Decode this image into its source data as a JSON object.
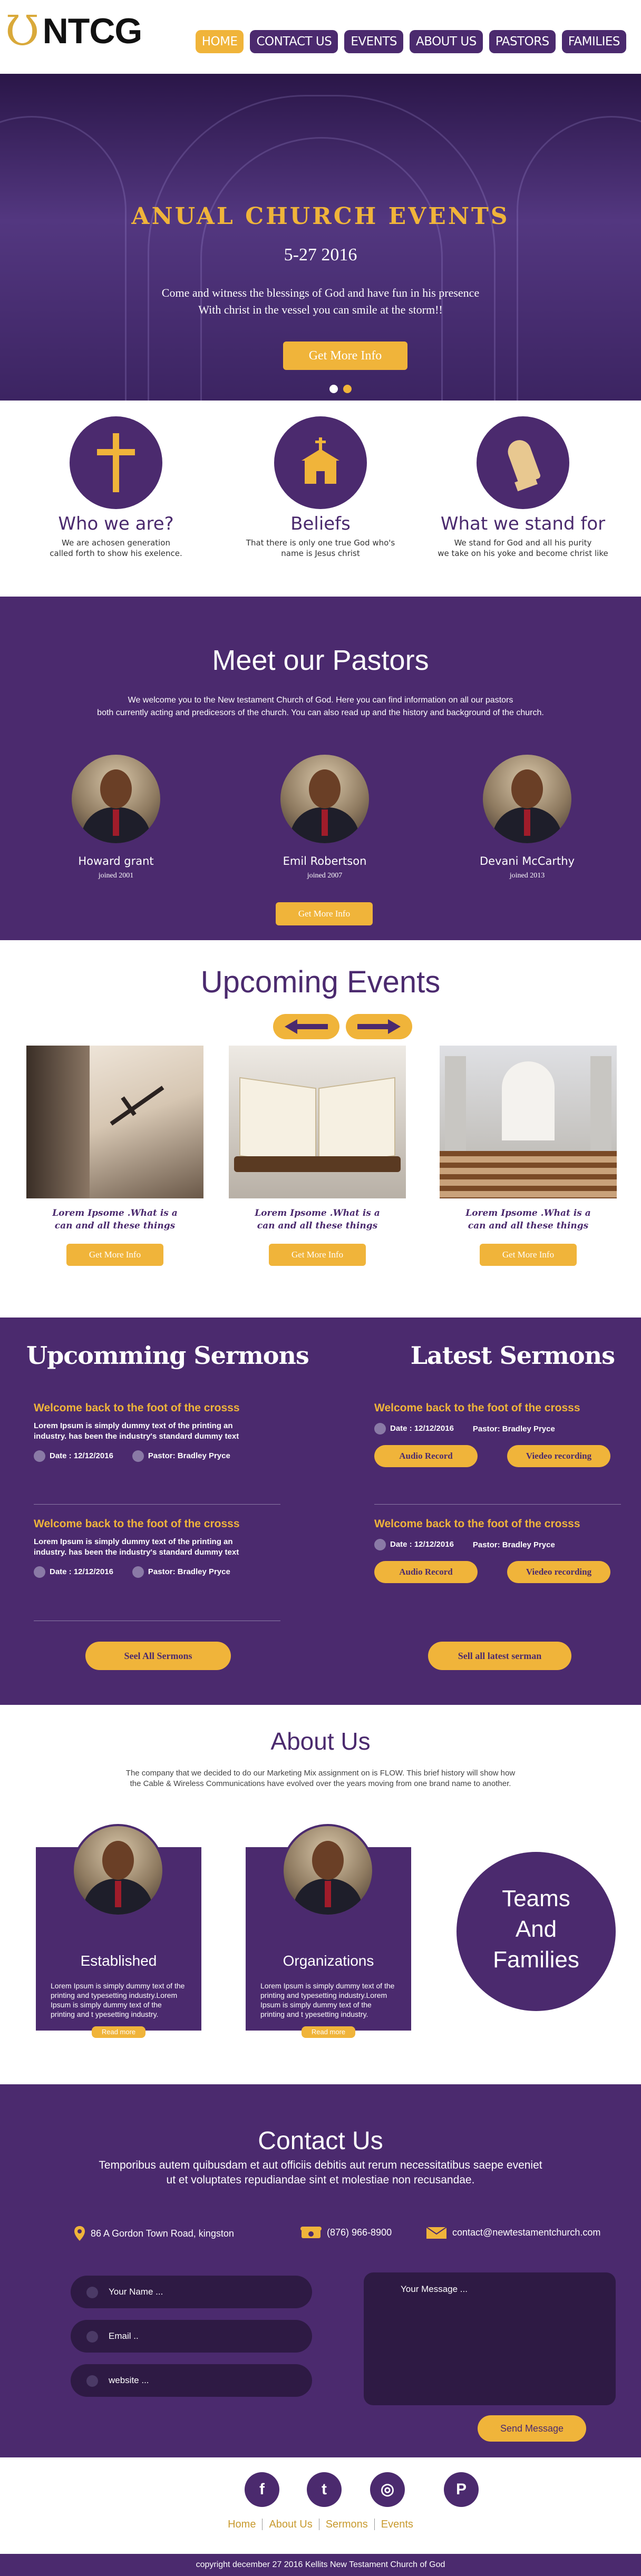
{
  "logo": {
    "mark": "Ʊ",
    "text": "NTCG"
  },
  "nav": {
    "items": [
      "HOME",
      "CONTACT US",
      "EVENTS",
      "ABOUT US",
      "PASTORS",
      "FAMILIES"
    ],
    "active": "HOME"
  },
  "hero": {
    "title": "ANUAL CHURCH EVENTS",
    "date": "5-27 2016",
    "line1": "Come and witness the blessings of God and have fun in his presence",
    "line2": "With christ in the vessel you can smile at the storm!!",
    "button": "Get More Info"
  },
  "features": [
    {
      "title": "Who we are?",
      "line1": "We are achosen generation",
      "line2": "called forth to show his exelence.",
      "icon": "cross-icon"
    },
    {
      "title": "Beliefs",
      "line1": "That there is only one true God who's",
      "line2": "name is Jesus christ",
      "icon": "church-icon"
    },
    {
      "title": "What we stand for",
      "line1": "We stand for God and all his purity",
      "line2": "we take on his yoke and become christ like",
      "icon": "praying-hands-icon"
    }
  ],
  "pastors": {
    "title": "Meet our Pastors",
    "intro1": "We welcome you to the New testament Church of God. Here you can find information on all our pastors",
    "intro2": "both currently acting and predicesors of the church. You can also read up and the history and background of the church.",
    "people": [
      {
        "name": "Howard grant",
        "joined": "joined 2001"
      },
      {
        "name": "Emil Robertson",
        "joined": "joined 2007"
      },
      {
        "name": "Devani McCarthy",
        "joined": "joined 2013"
      }
    ],
    "button": "Get More Info"
  },
  "events": {
    "title": "Upcoming Events",
    "items": [
      {
        "line1": "Lorem Ipsome .What is a",
        "line2": "can and all these things",
        "button": "Get More Info"
      },
      {
        "line1": "Lorem Ipsome .What is a",
        "line2": "can and all these things",
        "button": "Get More Info"
      },
      {
        "line1": "Lorem Ipsome .What is a",
        "line2": "can and all these things",
        "button": "Get More Info"
      }
    ]
  },
  "sermons": {
    "upcoming_title": "Upcomming Sermons",
    "latest_title": "Latest Sermons",
    "upcoming": [
      {
        "title": "Welcome back to the foot of the crosss",
        "body1": "Lorem Ipsum is simply dummy text of the printing an",
        "body2": "industry.  has been the industry's standard dummy text",
        "date": "Date : 12/12/2016",
        "pastor": "Pastor: Bradley Pryce"
      },
      {
        "title": "Welcome back to the foot of the crosss",
        "body1": "Lorem Ipsum is simply dummy text of the printing an",
        "body2": "industry.  has been the industry's standard dummy text",
        "date": "Date : 12/12/2016",
        "pastor": "Pastor: Bradley Pryce"
      }
    ],
    "latest": [
      {
        "title": "Welcome back to the foot of the crosss",
        "date": "Date : 12/12/2016",
        "pastor": "Pastor: Bradley Pryce",
        "audio": "Audio Record",
        "video": "Viedeo recording"
      },
      {
        "title": "Welcome back to the foot of the crosss",
        "date": "Date : 12/12/2016",
        "pastor": "Pastor: Bradley Pryce",
        "audio": "Audio Record",
        "video": "Viedeo recording"
      }
    ],
    "see_all": "Seel All Sermons",
    "see_latest": "Sell all latest serman"
  },
  "about": {
    "title": "About Us",
    "intro1": "The company that we decided to do our Marketing Mix assignment on is FLOW. This brief history will show how",
    "intro2": "the Cable & Wireless Communications have evolved over the years moving from one brand name to another.",
    "cards": [
      {
        "title": "Established",
        "body": "Lorem Ipsum is simply dummy text of the printing and typesetting industry.Lorem Ipsum is simply dummy text of the printing and t ypesetting industry.",
        "button": "Read more"
      },
      {
        "title": "Organizations",
        "body": "Lorem Ipsum is simply dummy text of the printing and typesetting industry.Lorem Ipsum is simply dummy text of the printing and t ypesetting industry.",
        "button": "Read more"
      }
    ],
    "teams": [
      "Teams",
      "And",
      "Families"
    ]
  },
  "contact": {
    "title": "Contact Us",
    "intro1": "Temporibus autem quibusdam et aut officiis debitis aut rerum necessitatibus saepe eveniet",
    "intro2": "ut et voluptates repudiandae sint et molestiae non recusandae.",
    "address": "86 A Gordon Town Road, kingston",
    "phone": "(876) 966-8900",
    "email": "contact@newtestamentchurch.com",
    "name_placeholder": "Your Name ...",
    "email_placeholder": "Email ..",
    "website_placeholder": "website ...",
    "message_placeholder": "Your Message ...",
    "send": "Send Message"
  },
  "footer": {
    "social": [
      "f",
      "t",
      "◎",
      "P"
    ],
    "links": [
      "Home",
      "About Us",
      "Sermons",
      "Events"
    ],
    "copyright": "copyright december 27 2016 Kellits New Testament Church of God"
  },
  "colors": {
    "purple": "#4b2a6e",
    "gold": "#f0b43a"
  }
}
